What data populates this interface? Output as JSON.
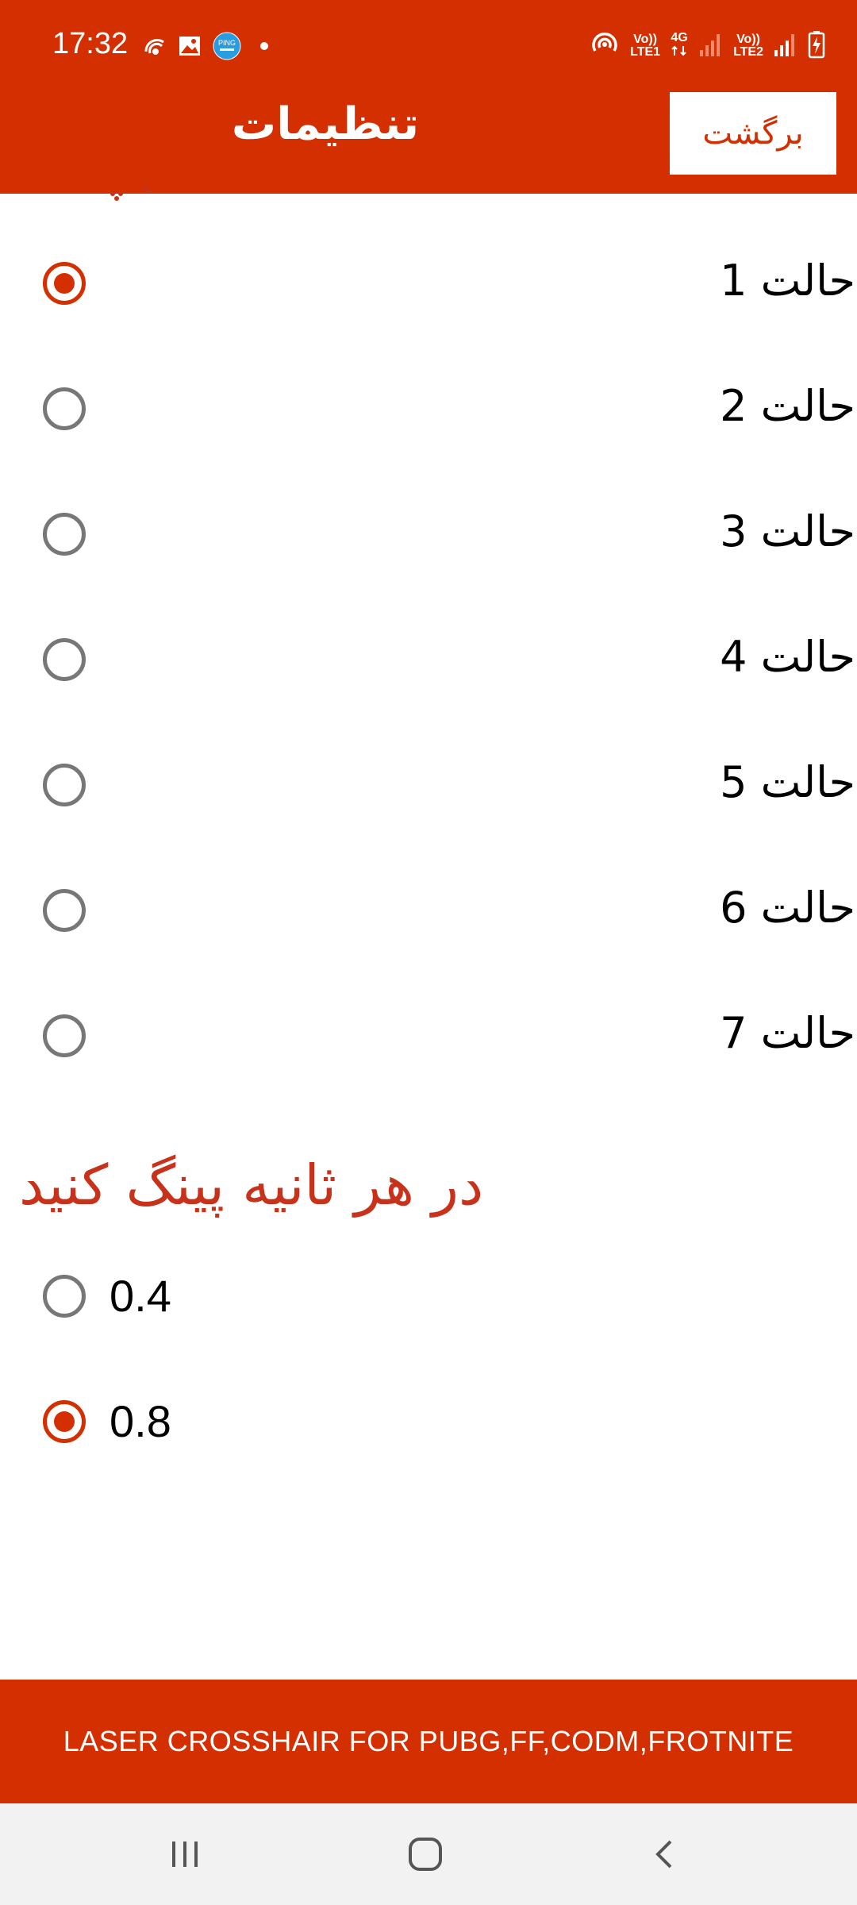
{
  "status_bar": {
    "time": "17:32",
    "left_icons": [
      "network-activity-icon",
      "gallery-icon",
      "ping-app-icon",
      "dot-icon"
    ],
    "right_icons": [
      "hotspot-icon",
      "volte-lte1-icon",
      "4g-icon",
      "signal-sim1-icon",
      "volte-lte2-icon",
      "signal-sim2-icon",
      "battery-charging-icon"
    ],
    "volte1_top": "Vo))",
    "volte1_bottom": "LTE1",
    "net_type": "4G",
    "volte2_top": "Vo))",
    "volte2_bottom": "LTE2"
  },
  "app_bar": {
    "title": "تنظیمات",
    "back_label": "برگشت"
  },
  "modes": {
    "items": [
      {
        "label": "حالت 1",
        "checked": true
      },
      {
        "label": "حالت 2",
        "checked": false
      },
      {
        "label": "حالت 3",
        "checked": false
      },
      {
        "label": "حالت 4",
        "checked": false
      },
      {
        "label": "حالت 5",
        "checked": false
      },
      {
        "label": "حالت 6",
        "checked": false
      },
      {
        "label": "حالت 7",
        "checked": false
      }
    ]
  },
  "ping_section": {
    "title": "در هر ثانیه پینگ کنید",
    "options": [
      {
        "label": "0.4",
        "checked": false
      },
      {
        "label": "0.8",
        "checked": true
      }
    ]
  },
  "banner": {
    "text": "LASER CROSSHAIR FOR PUBG,FF,CODM,FROTNITE"
  },
  "nav_bar": {
    "icons": [
      "recent-apps-icon",
      "home-icon",
      "back-icon"
    ]
  },
  "colors": {
    "brand": "#d32f00",
    "section_title": "#c8321b",
    "radio_unchecked": "#777777"
  }
}
